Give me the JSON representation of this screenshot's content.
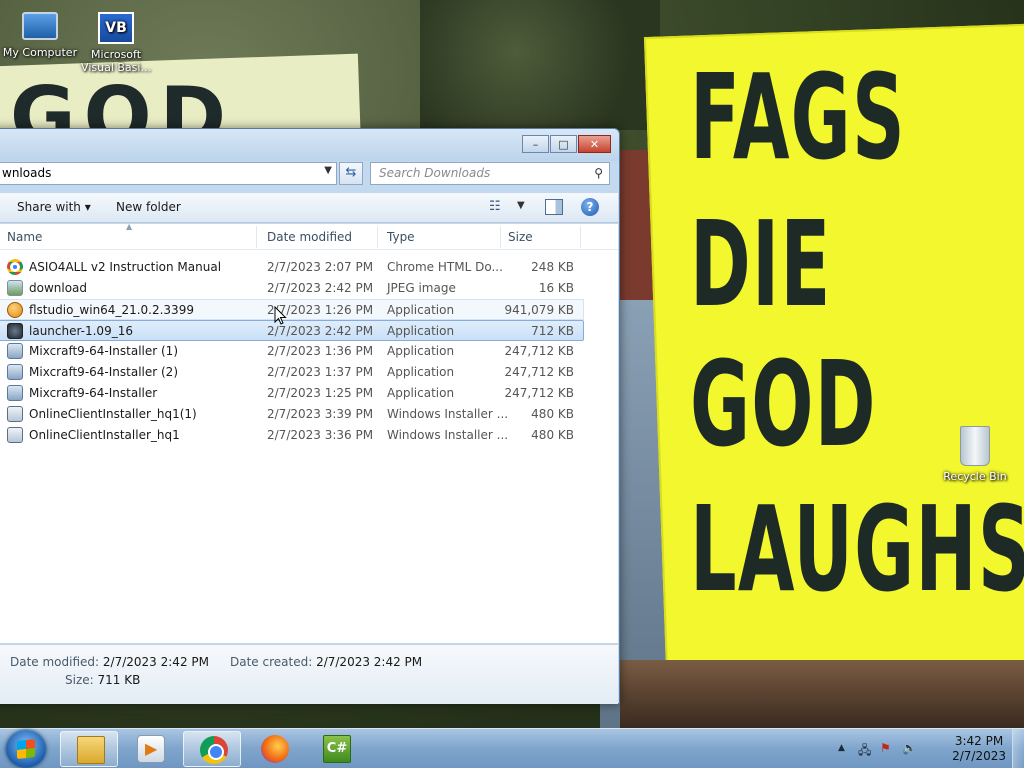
{
  "desktop": {
    "icons": [
      {
        "label": "My Computer"
      },
      {
        "label": "Microsoft Visual Basi..."
      },
      {
        "label": "Recycle Bin"
      }
    ],
    "wallpaper_text": {
      "right_sign": [
        "FAGS",
        "DIE",
        "GOD",
        "LAUGHS"
      ],
      "left_sign": "GOD"
    }
  },
  "explorer": {
    "address": "wnloads",
    "search_placeholder": "Search Downloads",
    "caption_buttons": {
      "minimize": "–",
      "maximize": "□",
      "close": "✕"
    },
    "toolbar": {
      "share_with": "Share with ▾",
      "new_folder": "New folder",
      "help": "?"
    },
    "columns": {
      "name": "Name",
      "date_modified": "Date modified",
      "type": "Type",
      "size": "Size"
    },
    "files": [
      {
        "name": "ASIO4ALL v2 Instruction Manual",
        "date": "2/7/2023 2:07 PM",
        "type": "Chrome HTML Do...",
        "size": "248 KB",
        "icon": "chrome-icon"
      },
      {
        "name": "download",
        "date": "2/7/2023 2:42 PM",
        "type": "JPEG image",
        "size": "16 KB",
        "icon": "jpeg-icon"
      },
      {
        "name": "flstudio_win64_21.0.2.3399",
        "date": "2/7/2023 1:26 PM",
        "type": "Application",
        "size": "941,079 KB",
        "icon": "flstudio-icon"
      },
      {
        "name": "launcher-1.09_16",
        "date": "2/7/2023 2:42 PM",
        "type": "Application",
        "size": "712 KB",
        "icon": "launcher-icon"
      },
      {
        "name": "Mixcraft9-64-Installer (1)",
        "date": "2/7/2023 1:36 PM",
        "type": "Application",
        "size": "247,712 KB",
        "icon": "installer-icon"
      },
      {
        "name": "Mixcraft9-64-Installer (2)",
        "date": "2/7/2023 1:37 PM",
        "type": "Application",
        "size": "247,712 KB",
        "icon": "installer-icon"
      },
      {
        "name": "Mixcraft9-64-Installer",
        "date": "2/7/2023 1:25 PM",
        "type": "Application",
        "size": "247,712 KB",
        "icon": "installer-icon"
      },
      {
        "name": "OnlineClientInstaller_hq1(1)",
        "date": "2/7/2023 3:39 PM",
        "type": "Windows Installer ...",
        "size": "480 KB",
        "icon": "msi-icon"
      },
      {
        "name": "OnlineClientInstaller_hq1",
        "date": "2/7/2023 3:36 PM",
        "type": "Windows Installer ...",
        "size": "480 KB",
        "icon": "msi-icon"
      }
    ],
    "selected_index": 3,
    "hover_index": 2,
    "details": {
      "date_modified_label": "Date modified:",
      "date_modified_value": "2/7/2023 2:42 PM",
      "date_created_label": "Date created:",
      "date_created_value": "2/7/2023 2:42 PM",
      "size_label": "Size:",
      "size_value": "711 KB"
    }
  },
  "taskbar": {
    "apps": [
      "windows-explorer",
      "media-player",
      "google-chrome",
      "firefox",
      "visual-csharp"
    ],
    "active_app": "windows-explorer",
    "clock_time": "3:42 PM",
    "clock_date": "2/7/2023"
  }
}
